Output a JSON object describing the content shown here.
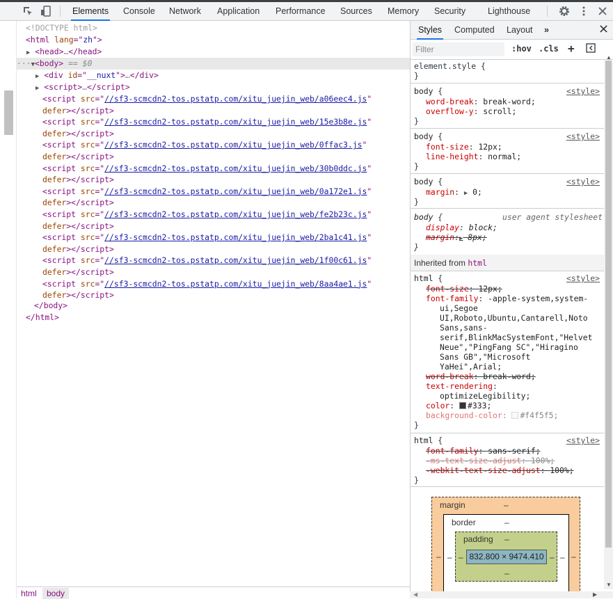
{
  "toolbar": {
    "tabs": [
      "Elements",
      "Console",
      "Network",
      "Application",
      "Performance",
      "Sources",
      "Memory",
      "Security",
      "Lighthouse"
    ],
    "active_tab": "Elements"
  },
  "elements": {
    "doctype": "<!DOCTYPE html>",
    "html_tag": "html",
    "html_attr": "lang",
    "html_attr_val": "zh",
    "head": "head",
    "body": "body",
    "body_sel": "== $0",
    "div_attr": "id",
    "div_id": "__nuxt",
    "script_tag": "script",
    "src_attr": "src",
    "defer": "defer",
    "scripts": [
      "//sf3-scmcdn2-tos.pstatp.com/xitu_juejin_web/a06eec4.js",
      "//sf3-scmcdn2-tos.pstatp.com/xitu_juejin_web/15e3b8e.js",
      "//sf3-scmcdn2-tos.pstatp.com/xitu_juejin_web/0ffac3.js",
      "//sf3-scmcdn2-tos.pstatp.com/xitu_juejin_web/30b0ddc.js",
      "//sf3-scmcdn2-tos.pstatp.com/xitu_juejin_web/0a172e1.js",
      "//sf3-scmcdn2-tos.pstatp.com/xitu_juejin_web/fe2b23c.js",
      "//sf3-scmcdn2-tos.pstatp.com/xitu_juejin_web/2ba1c41.js",
      "//sf3-scmcdn2-tos.pstatp.com/xitu_juejin_web/1f00c61.js",
      "//sf3-scmcdn2-tos.pstatp.com/xitu_juejin_web/8aa4ae1.js"
    ]
  },
  "breadcrumbs": [
    "html",
    "body"
  ],
  "styles": {
    "tabs": [
      "Styles",
      "Computed",
      "Layout"
    ],
    "filter_placeholder": "Filter",
    "hov": ":hov",
    "cls": ".cls",
    "element_style": "element.style {",
    "style_link": "<style>",
    "ua_label": "user agent stylesheet",
    "inherited_from": "Inherited from",
    "inherited_tag": "html",
    "rules": {
      "r1": {
        "sel": "body",
        "p1": "word-break",
        "v1": "break-word;",
        "p2": "overflow-y",
        "v2": "scroll;"
      },
      "r2": {
        "sel": "body",
        "p1": "font-size",
        "v1": "12px;",
        "p2": "line-height",
        "v2": "normal;"
      },
      "r3": {
        "sel": "body",
        "p1": "margin",
        "v1": "0;"
      },
      "r4": {
        "sel": "body",
        "p1": "display",
        "v1": "block;",
        "p2": "margin",
        "v2": "8px;"
      },
      "r5": {
        "sel": "html",
        "p_fs": "font-size",
        "v_fs": "12px;",
        "p_ff": "font-family",
        "ff_lines": [
          "-apple-system,system-",
          "ui,Segoe",
          "UI,Roboto,Ubuntu,Cantarell,Noto",
          "Sans,sans-",
          "serif,BlinkMacSystemFont,\"Helvet",
          "Neue\",\"PingFang SC\",\"Hiragino",
          "Sans GB\",\"Microsoft",
          "YaHei\",Arial;"
        ],
        "p_wb": "word-break",
        "v_wb": "break-word;",
        "p_tr": "text-rendering",
        "v_tr": "optimizeLegibility;",
        "p_c": "color",
        "v_c": "#333;",
        "p_bg": "background-color",
        "v_bg": "#f4f5f5;"
      },
      "r6": {
        "sel": "html",
        "p1": "font-family",
        "v1": "sans-serif;",
        "p2": "-ms-text-size-adjust",
        "v2": "100%;",
        "p3": "-webkit-text-size-adjust",
        "v3": "100%;"
      }
    },
    "color_swatch": "#333333",
    "bg_swatch": "#f4f5f5"
  },
  "box_model": {
    "margin_label": "margin",
    "border_label": "border",
    "padding_label": "padding",
    "dash": "–",
    "content": "832.800 × 9474.410"
  }
}
